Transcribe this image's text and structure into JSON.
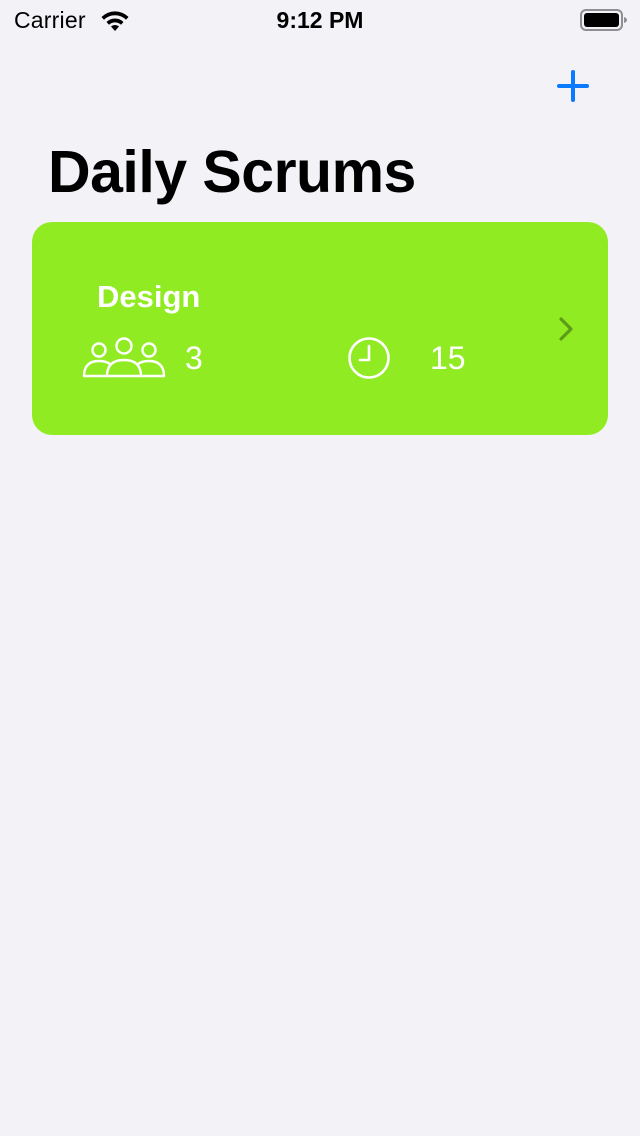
{
  "status_bar": {
    "carrier": "Carrier",
    "time": "9:12 PM",
    "wifi_icon": "wifi-icon",
    "battery_icon": "battery-icon"
  },
  "nav": {
    "add_icon": "plus-icon",
    "accent_color": "#0a7aff"
  },
  "page": {
    "title": "Daily Scrums",
    "background_color": "#f2f2f7"
  },
  "scrums": [
    {
      "title": "Design",
      "attendees": "3",
      "length_minutes": "15",
      "theme_color": "#91eb22",
      "people_icon": "people-icon",
      "clock_icon": "clock-icon",
      "chevron_icon": "chevron-right-icon"
    }
  ]
}
